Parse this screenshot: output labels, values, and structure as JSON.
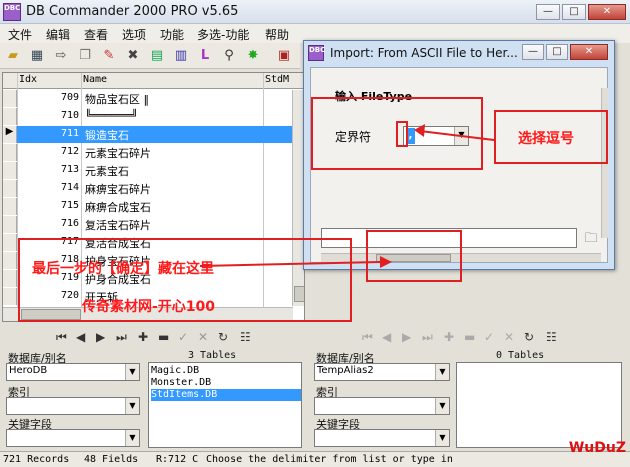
{
  "window": {
    "title": "DB Commander 2000 PRO v5.65",
    "icon_text": "DBC",
    "minimize": "—",
    "maximize": "□",
    "close": "✕"
  },
  "menu": [
    "文件",
    "编辑",
    "查看",
    "选项",
    "功能",
    "多选-功能",
    "帮助"
  ],
  "grid": {
    "columns": [
      "Idx",
      "Name",
      "StdM"
    ],
    "rows": [
      {
        "idx": "709",
        "name": "物品宝石区 ‖"
      },
      {
        "idx": "710",
        "name": "╚══════╝"
      },
      {
        "idx": "711",
        "name": "锻造宝石",
        "selected": true,
        "indicator": "▶"
      },
      {
        "idx": "712",
        "name": "元素宝石碎片"
      },
      {
        "idx": "713",
        "name": "元素宝石"
      },
      {
        "idx": "714",
        "name": "麻痹宝石碎片"
      },
      {
        "idx": "715",
        "name": "麻痹合成宝石"
      },
      {
        "idx": "716",
        "name": "复活宝石碎片"
      },
      {
        "idx": "717",
        "name": "复活合成宝石"
      },
      {
        "idx": "718",
        "name": "护身宝石碎片"
      },
      {
        "idx": "719",
        "name": "护身合成宝石"
      },
      {
        "idx": "720",
        "name": "开天斩"
      }
    ]
  },
  "dialog": {
    "title": "Import: From ASCII File to Her...",
    "section": "输入 FileType",
    "delimiter_label": "定界符",
    "delimiter_value": ","
  },
  "annotations": {
    "select_comma": "选择逗号",
    "last_step": "最后一步的【确定】藏在这里",
    "credit": "传奇素材网-开心100"
  },
  "left_panel": {
    "db_label": "数据库/别名",
    "db_value": "HeroDB",
    "table_count": "3 Tables",
    "tables": [
      "Magic.DB",
      "Monster.DB",
      "StdItems.DB"
    ],
    "selected_table": 2,
    "index_label": "索引",
    "key_label": "关键字段"
  },
  "right_panel": {
    "db_label": "数据库/别名",
    "db_value": "TempAlias2",
    "table_count": "0 Tables",
    "index_label": "索引",
    "key_label": "关键字段"
  },
  "status": {
    "records": "721 Records",
    "fields": "48 Fields",
    "position": "R:712 C",
    "hint": "Choose the delimiter from list or type in"
  },
  "watermark": "WuDuZ",
  "colors": {
    "selection": "#3399ff",
    "annotation": "#e02020",
    "dialog_frame": "#cfe0f2"
  }
}
